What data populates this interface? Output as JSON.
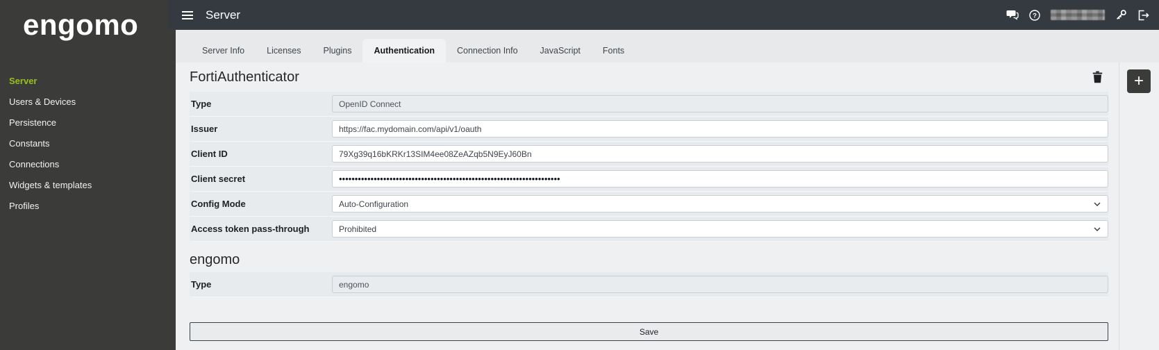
{
  "brand": {
    "logo_text": "engomo"
  },
  "topbar": {
    "title": "Server",
    "icons": {
      "menu": "hamburger-icon",
      "chat": "chat-bubbles-icon",
      "help": "question-mark-circle-icon",
      "user": "redacted-username",
      "key": "key-icon",
      "logout": "logout-icon"
    }
  },
  "sidebar": {
    "items": [
      {
        "label": "Server",
        "active": true
      },
      {
        "label": "Users & Devices",
        "active": false
      },
      {
        "label": "Persistence",
        "active": false
      },
      {
        "label": "Constants",
        "active": false
      },
      {
        "label": "Connections",
        "active": false
      },
      {
        "label": "Widgets & templates",
        "active": false
      },
      {
        "label": "Profiles",
        "active": false
      }
    ]
  },
  "tabs": {
    "items": [
      {
        "label": "Server Info",
        "active": false
      },
      {
        "label": "Licenses",
        "active": false
      },
      {
        "label": "Plugins",
        "active": false
      },
      {
        "label": "Authentication",
        "active": true
      },
      {
        "label": "Connection Info",
        "active": false
      },
      {
        "label": "JavaScript",
        "active": false
      },
      {
        "label": "Fonts",
        "active": false
      }
    ]
  },
  "sections": [
    {
      "title": "FortiAuthenticator",
      "rows": [
        {
          "label": "Type",
          "value": "OpenID Connect",
          "control": "text-disabled"
        },
        {
          "label": "Issuer",
          "value": "https://fac.mydomain.com/api/v1/oauth",
          "control": "text"
        },
        {
          "label": "Client ID",
          "value": "79Xg39q16bKRKr13SIM4ee08ZeAZqb5N9EyJ60Bn",
          "control": "text"
        },
        {
          "label": "Client secret",
          "value": "••••••••••••••••••••••••••••••••••••••••••••••••••••••••••••••••••••••",
          "control": "password"
        },
        {
          "label": "Config Mode",
          "value": "Auto-Configuration",
          "control": "select"
        },
        {
          "label": "Access token pass-through",
          "value": "Prohibited",
          "control": "select"
        }
      ]
    },
    {
      "title": "engomo",
      "rows": [
        {
          "label": "Type",
          "value": "engomo",
          "control": "text-disabled"
        }
      ]
    }
  ],
  "actions": {
    "save_label": "Save",
    "add_label": "+"
  },
  "colors": {
    "accent_green": "#95c11f",
    "sidebar_bg": "#3b3b3a",
    "topbar_bg": "#343a40",
    "content_bg": "#eef0f1"
  }
}
